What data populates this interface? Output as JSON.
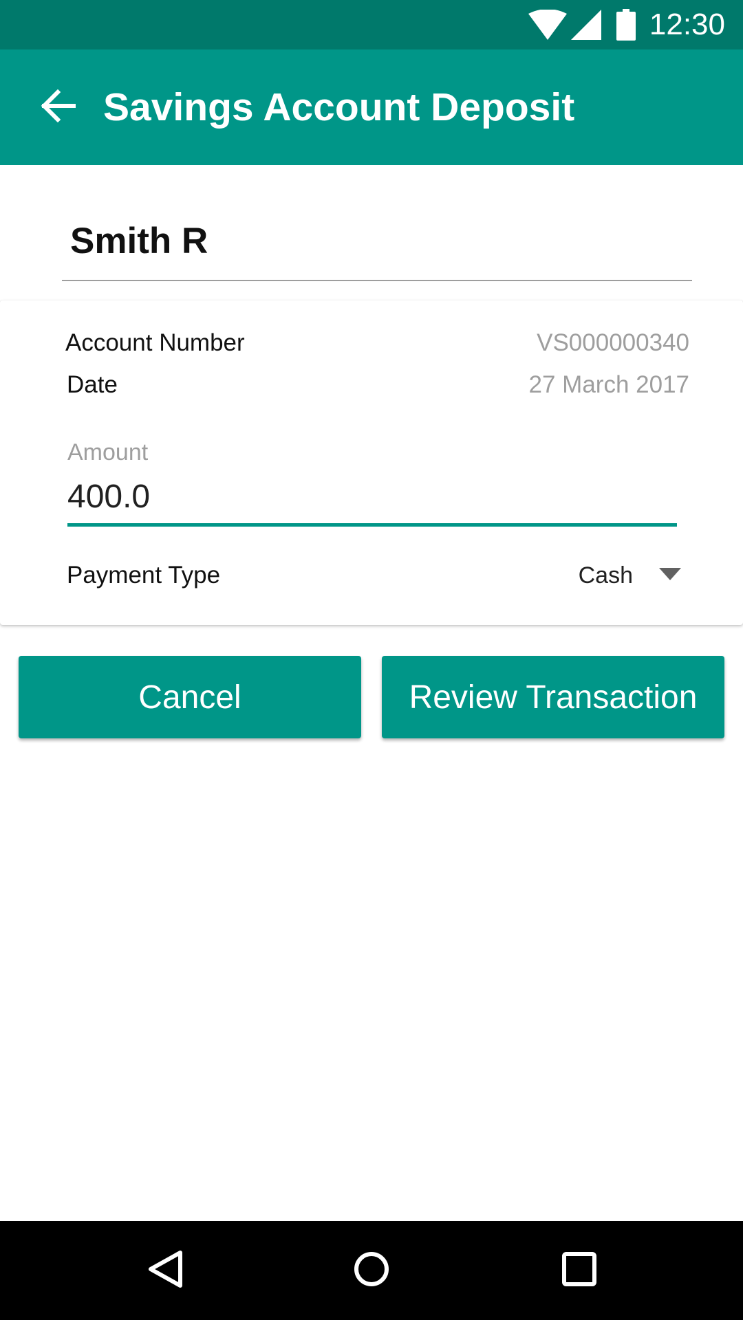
{
  "status_bar": {
    "time": "12:30",
    "icons": [
      "wifi-icon",
      "cell-signal-icon",
      "battery-icon"
    ]
  },
  "app_bar": {
    "title": "Savings Account Deposit",
    "back_icon": "arrow-back-icon"
  },
  "customer": {
    "name": "Smith R"
  },
  "details": {
    "account_number_label": "Account Number",
    "account_number_value": "VS000000340",
    "date_label": "Date",
    "date_value": "27 March 2017",
    "amount_label": "Amount",
    "amount_value": "400.0",
    "payment_type_label": "Payment Type",
    "payment_type_value": "Cash",
    "payment_type_options": [
      "Cash"
    ]
  },
  "actions": {
    "cancel_label": "Cancel",
    "review_label": "Review Transaction"
  },
  "nav_bar": {
    "icons": [
      "back-triangle-icon",
      "home-circle-icon",
      "recents-square-icon"
    ]
  },
  "colors": {
    "primary": "#009688",
    "primary_dark": "#00796b",
    "secondary_text": "#9e9e9e"
  }
}
